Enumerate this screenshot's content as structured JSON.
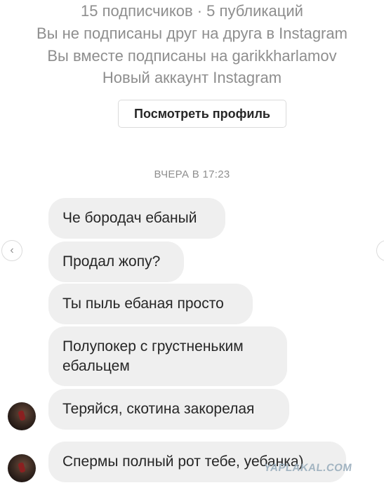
{
  "profile": {
    "stats": "15 подписчиков · 5 публикаций",
    "follow_status": "Вы не подписаны друг на друга в Instagram",
    "mutual": "Вы вместе подписаны на garikkharlamov",
    "account_note": "Новый аккаунт Instagram",
    "view_profile_label": "Посмотреть профиль"
  },
  "chat": {
    "timestamp": "ВЧЕРА В 17:23",
    "messages": [
      {
        "text": "Че бородач ебаный"
      },
      {
        "text": "Продал жопу?"
      },
      {
        "text": "Ты пыль ебаная просто"
      },
      {
        "text": "Полупокер с грустненьким\nебальцем"
      },
      {
        "text": "Теряйся, скотина закорелая"
      },
      {
        "text": "Спермы полный рот тебе, уебанка)"
      }
    ]
  },
  "watermark": "YAPLAKAL.COM",
  "icons": {
    "nav_left": "chevron-left-icon",
    "nav_right": "chevron-right-icon"
  }
}
